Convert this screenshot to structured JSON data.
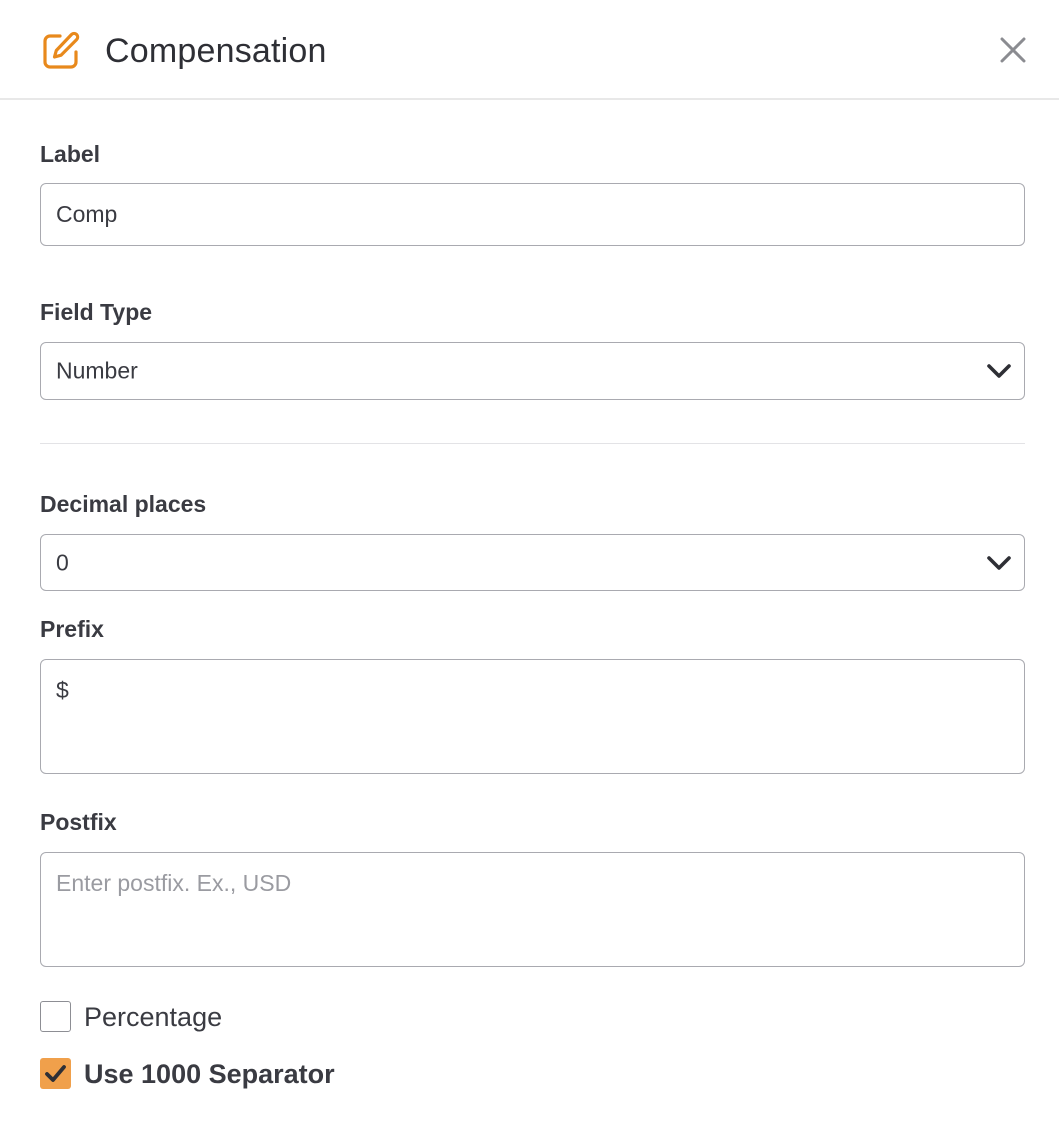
{
  "header": {
    "title": "Compensation",
    "icon": "edit-icon",
    "accent_color": "#e8891c",
    "close_icon": "close-icon"
  },
  "form": {
    "label_field": {
      "label": "Label",
      "value": "Comp"
    },
    "field_type": {
      "label": "Field Type",
      "selected": "Number"
    },
    "decimal_places": {
      "label": "Decimal places",
      "selected": "0"
    },
    "prefix": {
      "label": "Prefix",
      "value": "$"
    },
    "postfix": {
      "label": "Postfix",
      "value": "",
      "placeholder": "Enter postfix. Ex., USD"
    },
    "percentage": {
      "label": "Percentage",
      "checked": false
    },
    "separator": {
      "label": "Use 1000 Separator",
      "checked": true,
      "checked_color": "#f0a04b"
    }
  }
}
